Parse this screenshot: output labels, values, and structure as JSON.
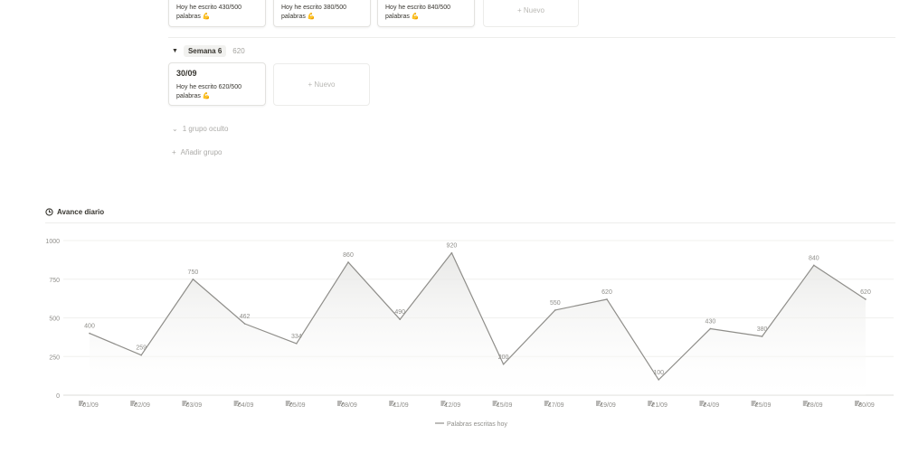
{
  "board": {
    "top_cards": [
      {
        "text": "Hoy he escrito 430/500 palabras 💪"
      },
      {
        "text": "Hoy he escrito 380/500 palabras 💪"
      },
      {
        "text": "Hoy he escrito 840/500 palabras 💪"
      }
    ],
    "new_label": "+ Nuevo",
    "group": {
      "name": "Semana 6",
      "count": "620"
    },
    "group_card": {
      "date": "30/09",
      "text": "Hoy he escrito 620/500 palabras 💪"
    },
    "hidden_groups": "1 grupo oculto",
    "add_group": "Añadir grupo"
  },
  "chart_section": {
    "title": "Avance diario",
    "icon": "chart-clock-icon"
  },
  "chart_data": {
    "type": "area",
    "categories": [
      "01/09",
      "02/09",
      "03/09",
      "04/09",
      "05/09",
      "08/09",
      "11/09",
      "12/09",
      "15/09",
      "17/09",
      "19/09",
      "21/09",
      "24/09",
      "25/09",
      "28/09",
      "30/09"
    ],
    "series": [
      {
        "name": "Palabras escritas hoy",
        "values": [
          400,
          259,
          750,
          462,
          334,
          860,
          490,
          920,
          200,
          550,
          620,
          100,
          430,
          380,
          840,
          620
        ]
      }
    ],
    "ylim": [
      0,
      1000
    ],
    "yticks": [
      "0",
      "250",
      "500",
      "750",
      "1000"
    ],
    "grid": true,
    "legend": "bottom",
    "colors": {
      "line": "#8f8e8a",
      "fill_top": "#e9e9e7"
    }
  }
}
